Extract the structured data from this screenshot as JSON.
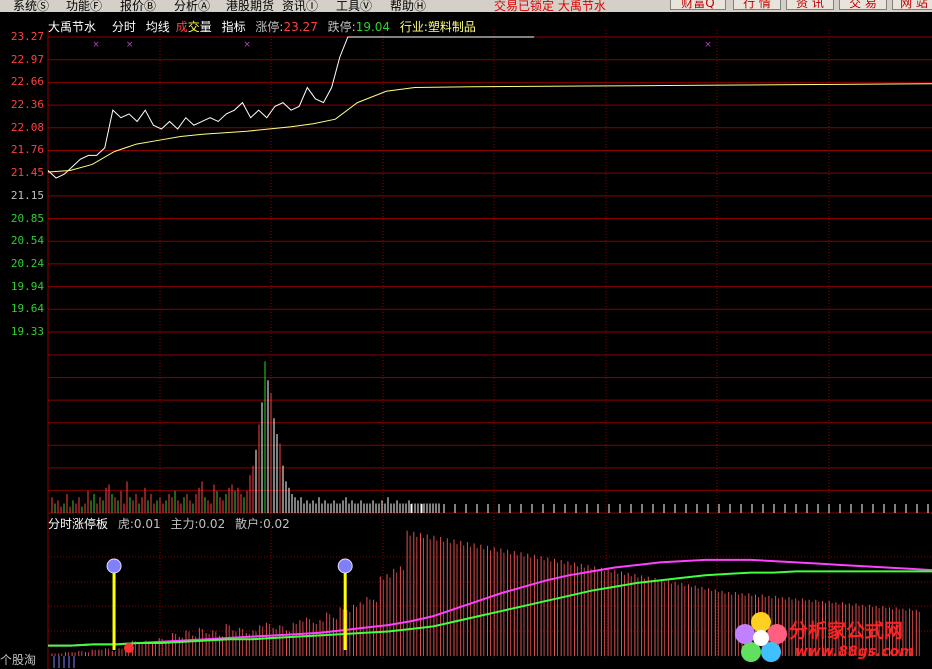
{
  "menu": {
    "items": [
      {
        "label": "系统Ⓢ",
        "left": 13
      },
      {
        "label": "功能Ⓕ",
        "left": 66
      },
      {
        "label": "报价Ⓑ",
        "left": 120
      },
      {
        "label": "分析Ⓐ",
        "left": 174
      },
      {
        "label": "港股期货",
        "left": 226
      },
      {
        "label": "资讯Ⓘ",
        "left": 282
      },
      {
        "label": "工具Ⓥ",
        "left": 336
      },
      {
        "label": "帮助Ⓗ",
        "left": 390
      }
    ],
    "lock_text": "交易已锁定  大禹节水",
    "buttons": [
      {
        "label": "财富Q",
        "left": 670,
        "width": 56
      },
      {
        "label": "行 情",
        "left": 733,
        "width": 48
      },
      {
        "label": "资 讯",
        "left": 786,
        "width": 48
      },
      {
        "label": "交 易",
        "left": 839,
        "width": 48
      },
      {
        "label": "网 站",
        "left": 892,
        "width": 44
      }
    ]
  },
  "info": {
    "stock_name": "大禹节水",
    "tab_fenshi": "分时",
    "tab_junxian": "均线",
    "tab_cheng": "成",
    "tab_jiao": "交",
    "tab_liang": "量",
    "tab_zhibiao": "指标",
    "limit_up_label": "涨停:",
    "limit_up_value": "23.27",
    "limit_down_label": "跌停:",
    "limit_down_value": "19.04",
    "industry": "行业:塑料制品"
  },
  "price_axis": {
    "labels": [
      "23.27",
      "22.97",
      "22.66",
      "22.36",
      "22.08",
      "21.76",
      "21.45",
      "21.15",
      "20.85",
      "20.54",
      "20.24",
      "19.94",
      "19.64",
      "19.33"
    ],
    "colors": {
      "up": "#ff4040",
      "flat": "#c0c0c0",
      "down": "#30d030"
    },
    "base_index": 7
  },
  "indicator": {
    "name": "分时涨停板",
    "hu_label": "虎:",
    "hu_value": "0.01",
    "zhuli_label": "主力:",
    "zhuli_value": "0.02",
    "sanhu_label": "散户:",
    "sanhu_value": "0.02"
  },
  "bottom_left_label": "个股淘",
  "watermark": {
    "title": "分析家公式网",
    "url": "www.88gs.com"
  },
  "chart_data": {
    "type": "line",
    "title": "大禹节水 分时",
    "ylim": [
      19.04,
      23.27
    ],
    "price_series": {
      "name": "价格",
      "minutes": [
        0,
        4,
        8,
        12,
        16,
        20,
        24,
        28,
        32,
        36,
        40,
        44,
        48,
        52,
        56,
        60,
        64,
        68,
        72,
        76,
        80,
        84,
        88,
        92,
        96,
        100,
        104,
        108,
        112,
        116,
        120,
        124,
        128,
        132,
        136,
        140,
        144,
        148,
        152,
        156,
        160,
        164,
        168,
        172,
        176,
        180,
        184,
        188,
        192,
        196,
        200,
        204,
        208,
        212,
        216,
        220,
        224,
        228,
        232,
        236,
        240
      ],
      "values": [
        21.5,
        21.4,
        21.45,
        21.55,
        21.65,
        21.7,
        21.7,
        21.8,
        22.3,
        22.2,
        22.25,
        22.15,
        22.3,
        22.1,
        22.05,
        22.15,
        22.05,
        22.2,
        22.1,
        22.15,
        22.2,
        22.15,
        22.25,
        22.3,
        22.4,
        22.2,
        22.3,
        22.2,
        22.35,
        22.4,
        22.3,
        22.35,
        22.6,
        22.45,
        22.4,
        22.6,
        23.0,
        23.27,
        23.27,
        23.27,
        23.27,
        23.27,
        23.27,
        23.27,
        23.27,
        23.27,
        23.27,
        23.27,
        23.27,
        23.27,
        23.27,
        23.27,
        23.27,
        23.27,
        23.27,
        23.27,
        23.27,
        23.27,
        23.27,
        23.27,
        23.27
      ]
    },
    "avg_series": {
      "name": "均线",
      "minutes": [
        0,
        10,
        20,
        30,
        40,
        50,
        60,
        70,
        80,
        90,
        100,
        110,
        120,
        130,
        140,
        145,
        150,
        160,
        180,
        200,
        220,
        240
      ],
      "values": [
        21.48,
        21.5,
        21.58,
        21.75,
        21.85,
        21.9,
        21.95,
        21.98,
        22.0,
        22.02,
        22.05,
        22.08,
        22.12,
        22.18,
        22.4,
        22.55,
        22.6,
        22.61,
        22.62,
        22.63,
        22.64,
        22.65
      ]
    },
    "volume_markers_minutes": [
      20,
      34,
      83,
      275
    ],
    "volume_bars": {
      "values": [
        5,
        3,
        4,
        2,
        3,
        6,
        2,
        4,
        3,
        5,
        2,
        3,
        7,
        4,
        6,
        3,
        5,
        4,
        8,
        9,
        6,
        5,
        4,
        7,
        3,
        10,
        5,
        4,
        6,
        3,
        5,
        8,
        4,
        6,
        3,
        4,
        5,
        3,
        4,
        6,
        5,
        7,
        4,
        3,
        5,
        6,
        4,
        3,
        6,
        8,
        10,
        5,
        4,
        3,
        9,
        7,
        5,
        4,
        6,
        8,
        9,
        7,
        8,
        6,
        5,
        7,
        12,
        15,
        20,
        28,
        35,
        48,
        42,
        38,
        30,
        25,
        22,
        15,
        10,
        8,
        6,
        5,
        4,
        5,
        3,
        4,
        3,
        4,
        3,
        5,
        3,
        4,
        3,
        3,
        4,
        3,
        3,
        4,
        5,
        3,
        4,
        3,
        3,
        4,
        3,
        3,
        3,
        4,
        3,
        3,
        4,
        3,
        5,
        3,
        3,
        4,
        3,
        3,
        3,
        4,
        3,
        3,
        3,
        3,
        3,
        3,
        3,
        3,
        3,
        3
      ],
      "colors": [
        "r",
        "g",
        "r",
        "r",
        "g",
        "r",
        "r",
        "g",
        "r",
        "r",
        "g",
        "r",
        "r",
        "g",
        "g",
        "r",
        "r",
        "g",
        "r",
        "r",
        "g",
        "r",
        "g",
        "r",
        "r",
        "r",
        "g",
        "r",
        "r",
        "g",
        "r",
        "r",
        "g",
        "r",
        "r",
        "g",
        "r",
        "r",
        "g",
        "r",
        "r",
        "g",
        "r",
        "r",
        "g",
        "r",
        "r",
        "g",
        "r",
        "r",
        "r",
        "g",
        "r",
        "r",
        "r",
        "g",
        "r",
        "r",
        "g",
        "r",
        "r",
        "g",
        "r",
        "r",
        "g",
        "r",
        "r",
        "r",
        "w",
        "r",
        "w",
        "g",
        "w",
        "r",
        "w",
        "w",
        "r",
        "w",
        "w",
        "w",
        "w",
        "w",
        "w",
        "w",
        "w",
        "w",
        "w",
        "w",
        "w",
        "w",
        "w",
        "w",
        "w",
        "w",
        "w",
        "w",
        "w",
        "w",
        "w",
        "w",
        "w",
        "w",
        "w",
        "w",
        "w",
        "w",
        "w",
        "w",
        "w",
        "w",
        "w",
        "w",
        "w",
        "w",
        "w",
        "w",
        "w",
        "w",
        "w",
        "w",
        "w",
        "w",
        "w",
        "w",
        "w",
        "w",
        "w",
        "w",
        "w",
        "w"
      ],
      "ylim": [
        0,
        50
      ]
    },
    "indicator_bars": {
      "values": [
        2,
        2,
        3,
        3,
        4,
        3,
        5,
        5,
        6,
        4,
        6,
        8,
        12,
        10,
        12,
        11,
        14,
        12,
        18,
        15,
        20,
        16,
        22,
        18,
        20,
        16,
        25,
        20,
        22,
        18,
        20,
        24,
        26,
        22,
        24,
        20,
        26,
        28,
        30,
        26,
        28,
        34,
        30,
        38,
        36,
        40,
        42,
        46,
        44,
        62,
        64,
        68,
        70,
        98,
        97,
        96,
        95,
        94,
        93,
        92,
        91,
        90,
        89,
        88,
        87,
        86,
        85,
        84,
        83,
        82,
        81,
        80,
        79,
        78,
        77,
        76,
        75,
        74,
        73,
        72,
        71,
        70,
        69,
        68,
        67,
        66,
        65,
        64,
        63,
        62,
        61,
        60,
        59,
        58,
        57,
        56,
        55,
        54,
        53,
        52,
        51,
        50,
        50,
        49,
        49,
        48,
        48,
        47,
        47,
        46,
        46,
        45,
        45,
        44,
        44,
        43,
        43,
        42,
        42,
        41,
        41,
        40,
        40,
        39,
        39,
        38,
        38,
        37,
        37,
        36
      ],
      "ylim": [
        0,
        100
      ]
    },
    "zhuli_series": {
      "name": "主力",
      "values": [
        5,
        5,
        6,
        6,
        7,
        8,
        9,
        10,
        11,
        12,
        13,
        14,
        15,
        17,
        19,
        21,
        24,
        28,
        34,
        40,
        46,
        51,
        56,
        60,
        63,
        66,
        68,
        70,
        71,
        72,
        72,
        72,
        71,
        70,
        69,
        68,
        67,
        66,
        65,
        64
      ]
    },
    "sanhu_series": {
      "name": "散户",
      "values": [
        5,
        5,
        6,
        6,
        7,
        7,
        8,
        9,
        10,
        10,
        11,
        12,
        13,
        14,
        15,
        16,
        18,
        20,
        24,
        28,
        32,
        36,
        40,
        44,
        48,
        51,
        54,
        56,
        58,
        60,
        61,
        62,
        62,
        63,
        63,
        63,
        63,
        63,
        63,
        63
      ]
    },
    "signal_minutes": [
      52,
      234
    ]
  },
  "colors": {
    "grid": "#8b0000",
    "price_line": "#ffffff",
    "avg_line": "#ffff80",
    "up": "#ff4040",
    "down": "#30d030",
    "zhuli": "#ff40ff",
    "sanhu": "#40ff40",
    "signal": "#ffff00",
    "marker": "#c040c0"
  }
}
